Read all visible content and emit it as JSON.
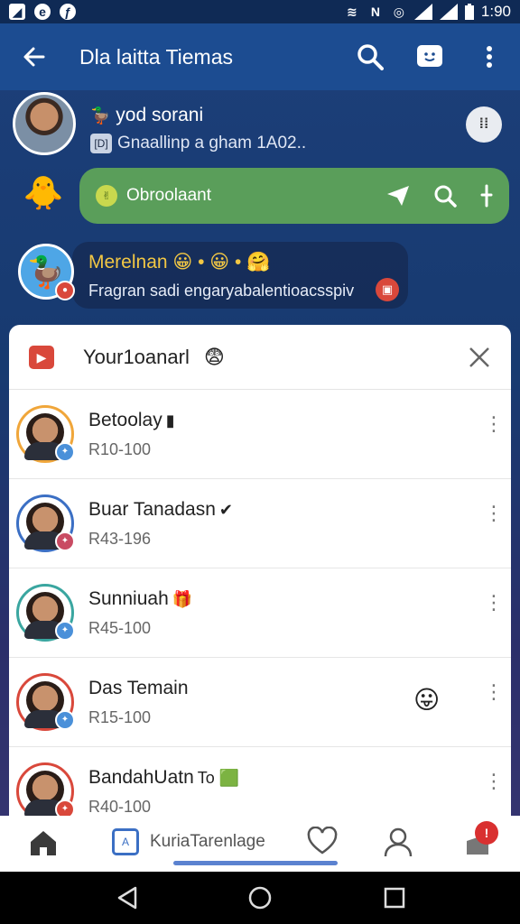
{
  "status_bar": {
    "time": "1:90",
    "icons": [
      "notification-icon",
      "edge-icon",
      "nfc-icon",
      "wifi-icon",
      "vibrate-icon",
      "data-saver-icon",
      "signal-icon",
      "signal-icon",
      "battery-icon"
    ]
  },
  "app_bar": {
    "title": "Dla laitta Tiemas",
    "icons": [
      "back-arrow-icon",
      "search-icon",
      "emoji-face-icon",
      "more-vert-icon"
    ]
  },
  "chat": {
    "msg1": {
      "name": "yod sorani",
      "subtitle": "Gnaallinp a gham 1A02..",
      "chip": "[D]",
      "action_label": "⁞⁞"
    },
    "msg2": {
      "text": "Obroolaant"
    },
    "msg3": {
      "name": "Merelnan 😀 • 😀 • 🤗",
      "subtitle": "Fragran sadi engaryabalentioacsspiv"
    }
  },
  "panel": {
    "title": "Your1oanarl",
    "rows": [
      {
        "name": "Betoolay",
        "tag": "▮",
        "sub": "R10-100",
        "avatar_color": "#f0a63a",
        "mini_color": "#4a90d9",
        "emoji": ""
      },
      {
        "name": "Buar Tanadasn",
        "tag": "✔",
        "sub": "R43-196",
        "avatar_color": "#3b6fc4",
        "mini_color": "#c94b63",
        "emoji": ""
      },
      {
        "name": "Sunniuah",
        "tag": "🎁",
        "sub": "R45-100",
        "avatar_color": "#3aa6a0",
        "mini_color": "#4a90d9",
        "emoji": ""
      },
      {
        "name": "Das Temain",
        "tag": "",
        "sub": "R15-100",
        "avatar_color": "#d9483b",
        "mini_color": "#4a90d9",
        "emoji": "😛"
      },
      {
        "name": "BandahUatn",
        "tag": "To 🟩",
        "sub": "R40-100",
        "avatar_color": "#d9483b",
        "mini_color": "#d9483b",
        "emoji": ""
      }
    ]
  },
  "bottom_nav": {
    "tab_label": "KuriaTarenlage",
    "badge": "!"
  }
}
